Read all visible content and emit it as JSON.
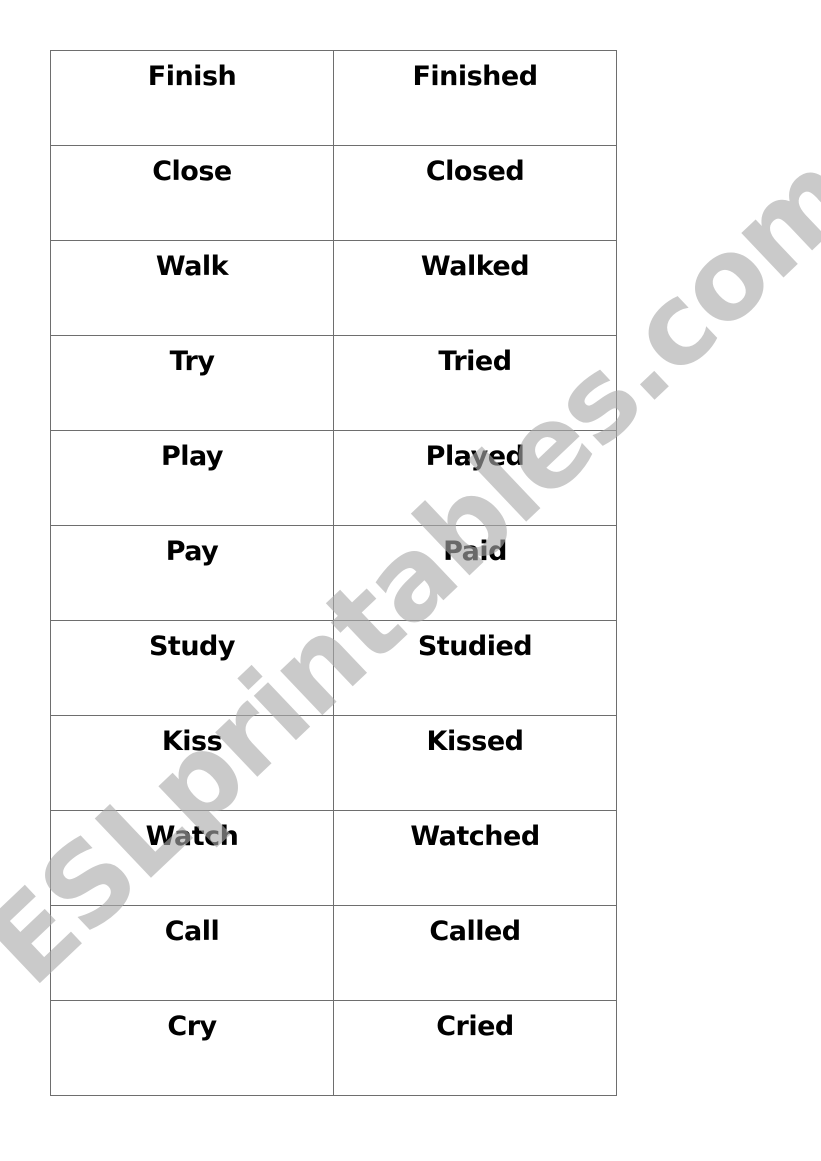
{
  "table": {
    "rows": [
      {
        "base": "Finish",
        "past": "Finished"
      },
      {
        "base": "Close",
        "past": "Closed"
      },
      {
        "base": "Walk",
        "past": "Walked"
      },
      {
        "base": "Try",
        "past": "Tried"
      },
      {
        "base": "Play",
        "past": "Played"
      },
      {
        "base": "Pay",
        "past": "Paid"
      },
      {
        "base": "Study",
        "past": "Studied"
      },
      {
        "base": "Kiss",
        "past": "Kissed"
      },
      {
        "base": "Watch",
        "past": "Watched"
      },
      {
        "base": "Call",
        "past": "Called"
      },
      {
        "base": "Cry",
        "past": "Cried"
      }
    ]
  },
  "watermark": {
    "text": "ESLprintables.com",
    "color": "#c8c8c8"
  }
}
